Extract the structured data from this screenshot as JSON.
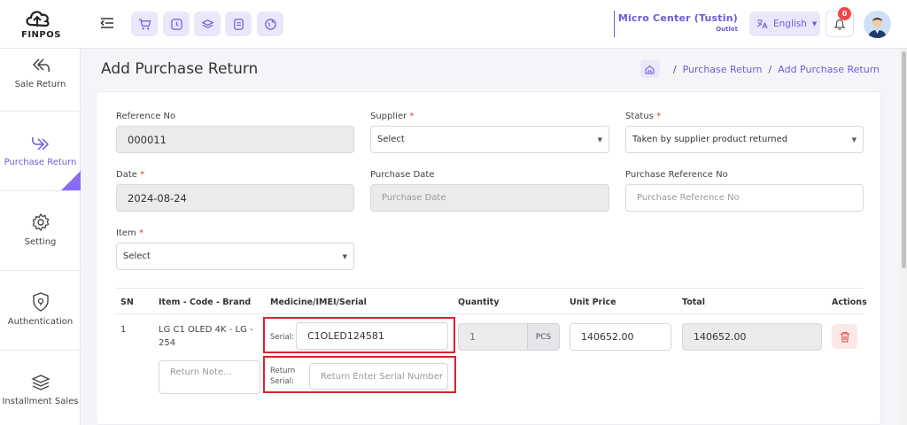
{
  "brand": {
    "logo_text": "FINPOS"
  },
  "header": {
    "store_name": "Micro Center (Tustin)",
    "store_sub": "Outlet",
    "language": "English",
    "notification_count": "0"
  },
  "sidebar": {
    "items": [
      {
        "label": "Sale Return",
        "icon": "sale-return-icon"
      },
      {
        "label": "Purchase Return",
        "icon": "purchase-return-icon",
        "active": true
      },
      {
        "label": "Setting",
        "icon": "gear-icon"
      },
      {
        "label": "Authentication",
        "icon": "shield-icon"
      },
      {
        "label": "Installment Sales",
        "icon": "stack-icon"
      }
    ]
  },
  "page": {
    "title": "Add Purchase Return",
    "breadcrumb": [
      "Purchase Return",
      "Add Purchase Return"
    ]
  },
  "form": {
    "reference_label": "Reference No",
    "reference_value": "000011",
    "supplier_label": "Supplier",
    "supplier_value": "Select",
    "status_label": "Status",
    "status_value": "Taken by supplier product returned",
    "date_label": "Date",
    "date_value": "2024-08-24",
    "purchase_date_label": "Purchase Date",
    "purchase_date_placeholder": "Purchase Date",
    "purchase_ref_label": "Purchase Reference No",
    "purchase_ref_placeholder": "Purchase Reference No",
    "item_label": "Item",
    "item_value": "Select",
    "required_mark": "*"
  },
  "table": {
    "headers": [
      "SN",
      "Item - Code - Brand",
      "Medicine/IMEI/Serial",
      "Quantity",
      "Unit Price",
      "Total",
      "Actions"
    ],
    "row": {
      "sn": "1",
      "item_line1": "LG C1 OLED 4K - LG -",
      "item_line2": "254",
      "serial_label": "Serial:",
      "serial_value": "C1OLED124581",
      "quantity": "1",
      "unit": "PCS",
      "unit_price": "140652.00",
      "total": "140652.00",
      "return_note_placeholder": "Return Note...",
      "return_serial_label_1": "Return",
      "return_serial_label_2": "Serial:",
      "return_serial_placeholder": "Return Enter Serial Number"
    }
  }
}
